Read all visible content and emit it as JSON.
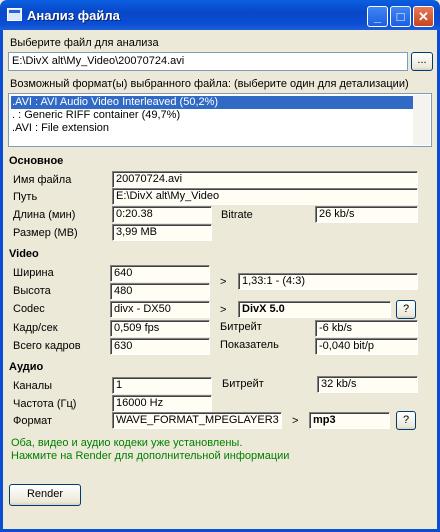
{
  "window": {
    "title": "Анализ файла"
  },
  "file_select": {
    "label": "Выберите файл для анализа",
    "path": "E:\\DivX alt\\My_Video\\20070724.avi",
    "browse_label": "..."
  },
  "formats": {
    "label": "Возможный формат(ы) выбранного файла: (выберите один для детализации)",
    "items": [
      ".AVI : AVI Audio Video Interleaved (50,2%)",
      ". : Generic RIFF container (49,7%)",
      ".AVI : File extension"
    ]
  },
  "general": {
    "header": "Основное",
    "name_label": "Имя файла",
    "name": "20070724.avi",
    "path_label": "Путь",
    "path": "E:\\DivX alt\\My_Video",
    "duration_label": "Длина (мин)",
    "duration": "0:20.38",
    "bitrate_label": "Bitrate",
    "bitrate": "26 kb/s",
    "size_label": "Размер (MB)",
    "size": "3,99 MB"
  },
  "video": {
    "header": "Video",
    "width_label": "Ширина",
    "width": "640",
    "height_label": "Высота",
    "height": "480",
    "aspect": "1,33:1 - (4:3)",
    "codec_label": "Codec",
    "codec": "divx - DX50",
    "codec_name": "DivX 5.0",
    "help_label": "?",
    "fps_label": "Кадр/сек",
    "fps": "0,509 fps",
    "bitrate_label": "Битрейт",
    "bitrate": "-6 kb/s",
    "frames_label": "Всего кадров",
    "frames": "630",
    "index_label": "Показатель",
    "index": "-0,040 bit/p"
  },
  "audio": {
    "header": "Аудио",
    "channels_label": "Каналы",
    "channels": "1",
    "bitrate_label": "Битрейт",
    "bitrate": "32 kb/s",
    "freq_label": "Частота (Гц)",
    "freq": "16000 Hz",
    "format_label": "Формат",
    "format": "WAVE_FORMAT_MPEGLAYER3",
    "format_name": "mp3",
    "help_label": "?"
  },
  "status": {
    "line1": "Оба, видео и аудио кодеки уже установлены.",
    "line2": "Нажмите на Render для дополнительной информации"
  },
  "arrow": ">",
  "render_label": "Render",
  "title_buttons": {
    "minimize": "_",
    "maximize": "□",
    "close": "✕"
  }
}
